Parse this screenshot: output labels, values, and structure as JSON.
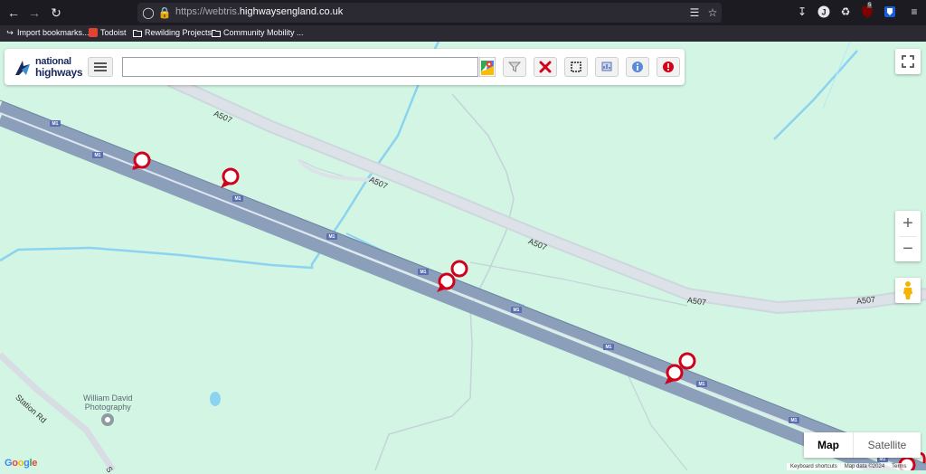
{
  "browser": {
    "url_prefix": "https://webtris.",
    "url_domain": "highwaysengland.co.uk",
    "badge_count": "5"
  },
  "bookmarks": [
    {
      "label": "Import bookmarks..."
    },
    {
      "label": "Todoist"
    },
    {
      "label": "Rewilding Projects"
    },
    {
      "label": "Community Mobility ..."
    }
  ],
  "toolbar": {
    "logo_line1": "national",
    "logo_line2": "highways",
    "search_value": "",
    "search_placeholder": ""
  },
  "map": {
    "road_labels": {
      "a507_1": "A507",
      "a507_2": "A507",
      "a507_3": "A507",
      "a507_4": "A507",
      "a507_5": "A507",
      "station_rd": "Station Rd",
      "station_rd_2": "S"
    },
    "m1_shield": "M1",
    "poi": {
      "name_line1": "William David",
      "name_line2": "Photography"
    },
    "zoom_in": "+",
    "zoom_out": "−",
    "map_type_map": "Map",
    "map_type_satellite": "Satellite",
    "google": "Google",
    "attribution": {
      "shortcuts": "Keyboard shortcuts",
      "map_data": "Map data ©2024",
      "terms": "Terms"
    }
  },
  "colors": {
    "map_bg": "#d3f5e3",
    "motorway": "#8c9fba",
    "a_road": "#d7dde3",
    "water": "#8cd3f0",
    "marker": "#d0021b",
    "brand": "#1a2b5b"
  }
}
